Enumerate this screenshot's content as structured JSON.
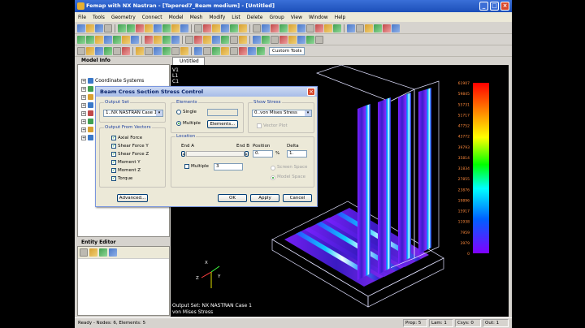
{
  "window": {
    "title": "Femap with NX Nastran - [Tapered7_Beam medium] - [Untitled]"
  },
  "menu": [
    "File",
    "Tools",
    "Geometry",
    "Connect",
    "Model",
    "Mesh",
    "Modify",
    "List",
    "Delete",
    "Group",
    "View",
    "Window",
    "Help"
  ],
  "toolbar": {
    "custom_tools": "Custom Tools"
  },
  "model_info": {
    "title": "Model Info",
    "coordinate_systems": "Coordinate Systems"
  },
  "entity_editor": {
    "title": "Entity Editor"
  },
  "view": {
    "tab": "Untitled",
    "corner": [
      "V1",
      "L1",
      "C1"
    ],
    "output_set": "Output Set: NX NASTRAN Case 1",
    "stress": "von Mises Stress"
  },
  "legend_values": [
    "61907",
    "59845",
    "55731",
    "51717",
    "47752",
    "43772",
    "39793",
    "35814",
    "31834",
    "27855",
    "23876",
    "19896",
    "15917",
    "11938",
    "7959",
    "3979",
    "0"
  ],
  "dialog": {
    "title": "Beam Cross Section Stress Control",
    "output_set_label": "Output Set",
    "output_set_value": "1..NX NASTRAN Case 1",
    "elements_label": "Elements",
    "single": "Single",
    "multiple": "Multiple",
    "elements_btn": "Elements...",
    "show_stress_label": "Show Stress",
    "show_stress_value": "0..von Mises Stress",
    "vector_plot": "Vector Plot",
    "output_from_vectors": "Output From Vectors",
    "vectors": [
      "Axial Force",
      "Shear Force Y",
      "Shear Force Z",
      "Moment Y",
      "Moment Z",
      "Torque"
    ],
    "location_label": "Location",
    "end_a": "End A",
    "end_b": "End B",
    "position_label": "Position",
    "position_value": "0.",
    "percent": "%",
    "delta_label": "Delta",
    "delta_value": "1.",
    "multiple_loc": "Multiple",
    "multiple_value": "3",
    "screen_space": "Screen Space",
    "model_space": "Model Space",
    "advanced": "Advanced...",
    "ok": "OK",
    "apply": "Apply",
    "cancel": "Cancel"
  },
  "status": {
    "ready": "Ready - Nodes: 6, Elements: 5",
    "prop": "Prop: 5",
    "lam": "Lam: 1",
    "csys": "Csys: 0",
    "out": "Out: 1"
  },
  "colors": {
    "legend_top": "#ff0000",
    "legend_bottom": "#8000ff",
    "viewport_bg": "#000000"
  }
}
